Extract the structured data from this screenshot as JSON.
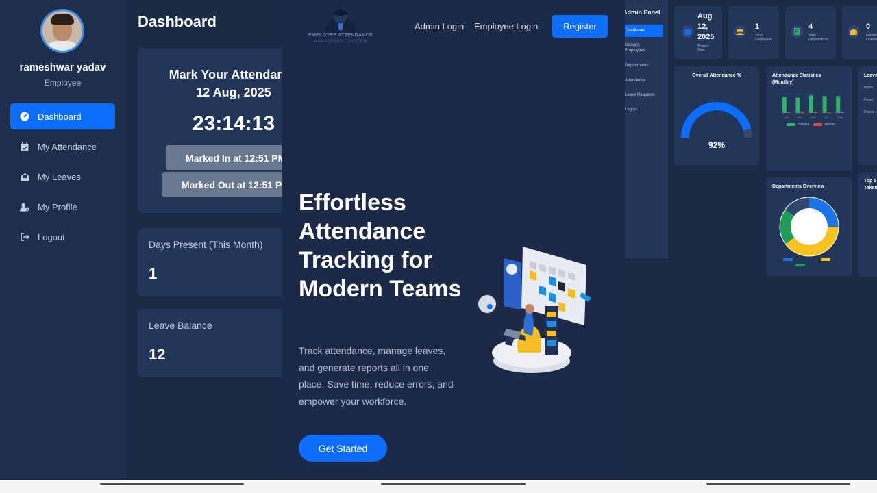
{
  "employee_dashboard": {
    "user": {
      "name": "rameshwar yadav",
      "role": "Employee"
    },
    "nav": [
      {
        "label": "Dashboard",
        "icon": "gauge-icon",
        "active": true
      },
      {
        "label": "My Attendance",
        "icon": "calendar-check-icon",
        "active": false
      },
      {
        "label": "My Leaves",
        "icon": "envelope-open-icon",
        "active": false
      },
      {
        "label": "My Profile",
        "icon": "user-gear-icon",
        "active": false
      },
      {
        "label": "Logout",
        "icon": "sign-out-icon",
        "active": false
      }
    ],
    "page_title": "Dashboard",
    "attendance": {
      "title_line1": "Mark Your Attendance",
      "title_line2": "12 Aug, 2025",
      "clock": "23:14:13",
      "marked_in": "Marked In at 12:51 PM",
      "marked_out": "Marked Out at 12:51 PM"
    },
    "days_present": {
      "label": "Days Present (This Month)",
      "value": "1"
    },
    "leave_balance": {
      "label": "Leave Balance",
      "value": "12"
    }
  },
  "landing": {
    "logo_text": "EMPLOYEE ATTENDANCE",
    "logo_subtext": "MANAGEMENT SYSTEM",
    "nav": {
      "admin_login": "Admin Login",
      "employee_login": "Employee Login",
      "register": "Register"
    },
    "hero_title": "Effortless Attendance Tracking for Modern Teams",
    "hero_subtitle": "Track attendance, manage leaves, and generate reports all in one place. Save time, reduce errors, and empower your workforce.",
    "cta": "Get Started"
  },
  "admin_dashboard": {
    "sidebar_title": "Admin Panel",
    "nav": [
      "Dashboard",
      "Manage Employees",
      "Departments",
      "Attendance",
      "Leave Requests",
      "Logout"
    ],
    "kpis": [
      {
        "value_lines": [
          "Aug",
          "12,",
          "2025"
        ],
        "label": "Today's Date",
        "icon": "calendar-icon",
        "color": "#0d6efd"
      },
      {
        "value_lines": [
          "1"
        ],
        "label": "Total Employees",
        "icon": "users-icon",
        "color": "#f0b429"
      },
      {
        "value_lines": [
          "4"
        ],
        "label": "Total Departments",
        "icon": "building-icon",
        "color": "#2fb36b"
      },
      {
        "value_lines": [
          "0"
        ],
        "label": "Pending Leaves",
        "icon": "envelope-icon",
        "color": "#f0b429"
      }
    ],
    "overall_attendance": {
      "title": "Overall Attendance %",
      "value": 92,
      "display": "92%"
    },
    "attendance_statistics": {
      "title": "Attendance Statistics (Monthly)",
      "legend": [
        "Present",
        "Absent"
      ]
    },
    "leave_card_title": "Leave",
    "leave_rows": [
      "Appro",
      "Pendi",
      "Reject"
    ],
    "departments_overview": {
      "title": "Departments Overview"
    },
    "top_card_title": "Top 5 Taken"
  },
  "chart_data": [
    {
      "type": "pie",
      "title": "Overall Attendance %",
      "values": [
        92,
        8
      ],
      "colors": [
        "#0d6efd",
        "#3a4866"
      ]
    },
    {
      "type": "bar",
      "title": "Attendance Statistics (Monthly)",
      "categories": [
        "Jan",
        "Feb",
        "Mar",
        "Apr",
        "May"
      ],
      "series": [
        {
          "name": "Present",
          "values": [
            21,
            20,
            23,
            22,
            22
          ],
          "color": "#2fb36b"
        },
        {
          "name": "Absent",
          "values": [
            1,
            2,
            1,
            1,
            1
          ],
          "color": "#e0433d"
        }
      ],
      "ylim": [
        0,
        25
      ]
    },
    {
      "type": "pie",
      "title": "Departments Overview",
      "values": [
        25,
        40,
        20,
        15
      ],
      "colors": [
        "#1a73e8",
        "#f7c21b",
        "#1e9e58",
        "#2f4670"
      ]
    }
  ]
}
